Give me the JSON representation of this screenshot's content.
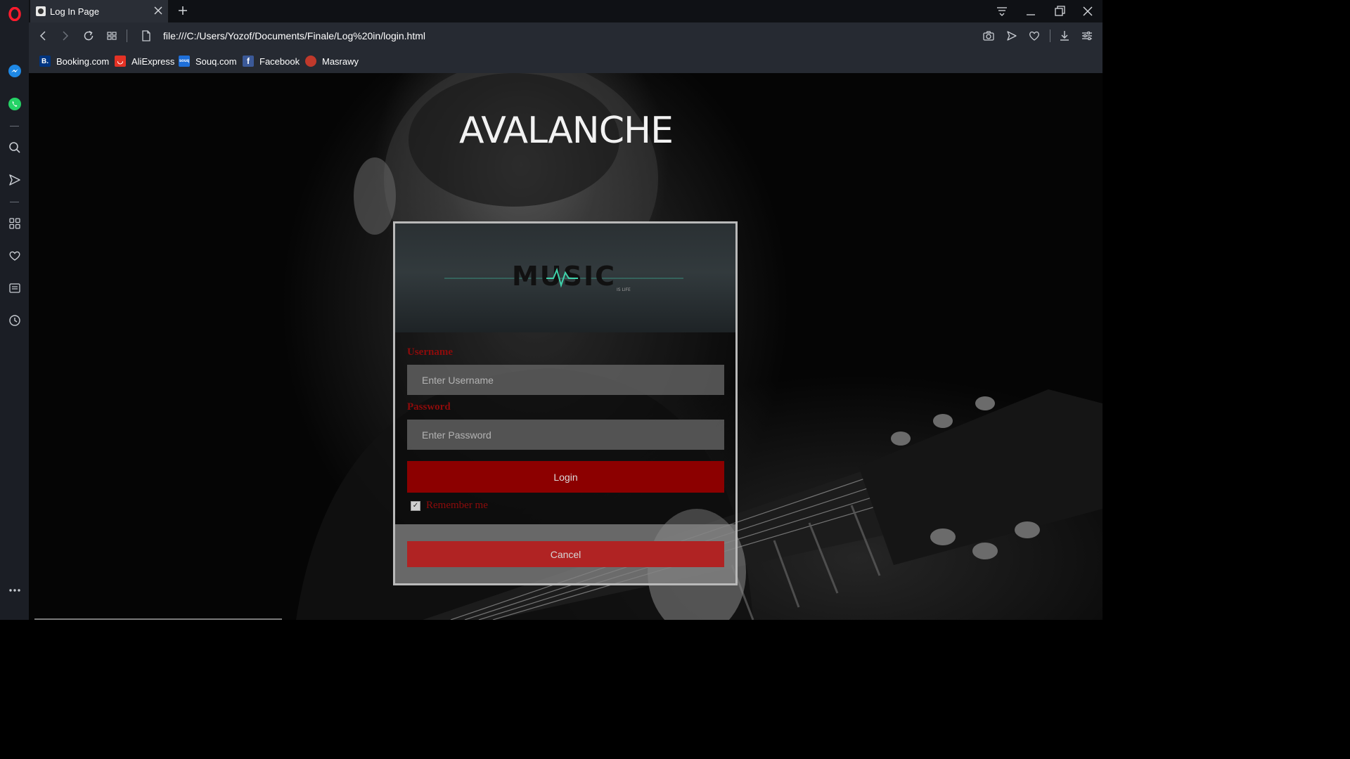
{
  "browser": {
    "tab": {
      "title": "Log In Page"
    },
    "url": "file:///C:/Users/Yozof/Documents/Finale/Log%20in/login.html",
    "bookmarks": [
      {
        "label": "Booking.com",
        "icon": "booking-icon",
        "color": "#003580"
      },
      {
        "label": "AliExpress",
        "icon": "aliexpress-icon",
        "color": "#e43225"
      },
      {
        "label": "Souq.com",
        "icon": "souq-icon",
        "color": "#1e6fd9"
      },
      {
        "label": "Facebook",
        "icon": "facebook-icon",
        "color": "#3b5998"
      },
      {
        "label": "Masrawy",
        "icon": "masrawy-icon",
        "color": "#c0392b"
      }
    ],
    "sidebar_icons": [
      "opera-logo-icon",
      "messenger-icon",
      "whatsapp-icon",
      "search-icon",
      "send-icon",
      "speed-dial-icon",
      "heart-icon",
      "news-icon",
      "history-icon",
      "more-icon"
    ]
  },
  "page": {
    "site_title": "AVALANCHE",
    "banner": {
      "logo_text": "MUSIC",
      "logo_subtext": "IS LIFE"
    },
    "form": {
      "username_label": "Username",
      "username_placeholder": "Enter Username",
      "password_label": "Password",
      "password_placeholder": "Enter Password",
      "login_label": "Login",
      "remember_label": "Remember me",
      "remember_checked": true,
      "cancel_label": "Cancel"
    }
  },
  "colors": {
    "accent_red": "#8c0000",
    "label_red": "#8e0b0b",
    "cancel_red": "#b02323",
    "chrome_dark": "#1b1e25"
  }
}
